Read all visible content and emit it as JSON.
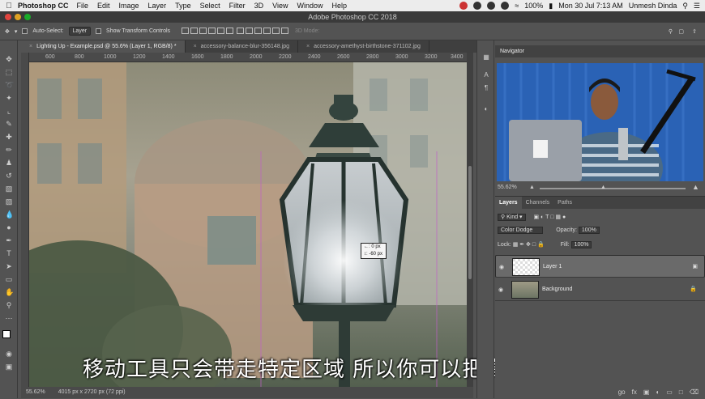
{
  "menubar": {
    "app": "Photoshop CC",
    "items": [
      "File",
      "Edit",
      "Image",
      "Layer",
      "Type",
      "Select",
      "Filter",
      "3D",
      "View",
      "Window",
      "Help"
    ],
    "battery": "100%",
    "datetime": "Mon 30 Jul  7:13 AM",
    "user": "Unmesh Dinda"
  },
  "window": {
    "title": "Adobe Photoshop CC 2018"
  },
  "options": {
    "auto_select_label": "Auto-Select:",
    "auto_select_value": "Layer",
    "show_transform_label": "Show Transform Controls",
    "mode_3d_label": "3D Mode:"
  },
  "tabs": [
    {
      "label": "Lighting Up - Example.psd @ 55.6% (Layer 1, RGB/8) *",
      "active": true
    },
    {
      "label": "accessory-balance-blur-356148.jpg",
      "active": false
    },
    {
      "label": "accessory-amethyst-birthstone-371102.jpg",
      "active": false
    }
  ],
  "ruler": [
    "600",
    "800",
    "1000",
    "1200",
    "1400",
    "1600",
    "1800",
    "2000",
    "2200",
    "2400",
    "2600",
    "2800",
    "3000",
    "3200",
    "3400"
  ],
  "tooltip": {
    "x": "←: 0 px",
    "y": "↕: -60 px"
  },
  "status": {
    "zoom": "55.62%",
    "doc": "4015 px x 2720 px (72 ppi)"
  },
  "subtitle": "移动工具只会带走特定区域 所以你可以把高光放在这",
  "navigator": {
    "title": "Navigator",
    "zoom": "55.62%"
  },
  "layers": {
    "tabs": [
      "Layers",
      "Channels",
      "Paths"
    ],
    "kind": "Kind",
    "blend": "Color Dodge",
    "opacity_label": "Opacity:",
    "opacity": "100%",
    "lock_label": "Lock:",
    "fill_label": "Fill:",
    "fill": "100%",
    "items": [
      {
        "name": "Layer 1",
        "selected": true
      },
      {
        "name": "Background",
        "selected": false
      }
    ],
    "footer": [
      "go",
      "fx"
    ]
  },
  "colors": {
    "accent": "#2b62b5",
    "panel": "#535353"
  }
}
